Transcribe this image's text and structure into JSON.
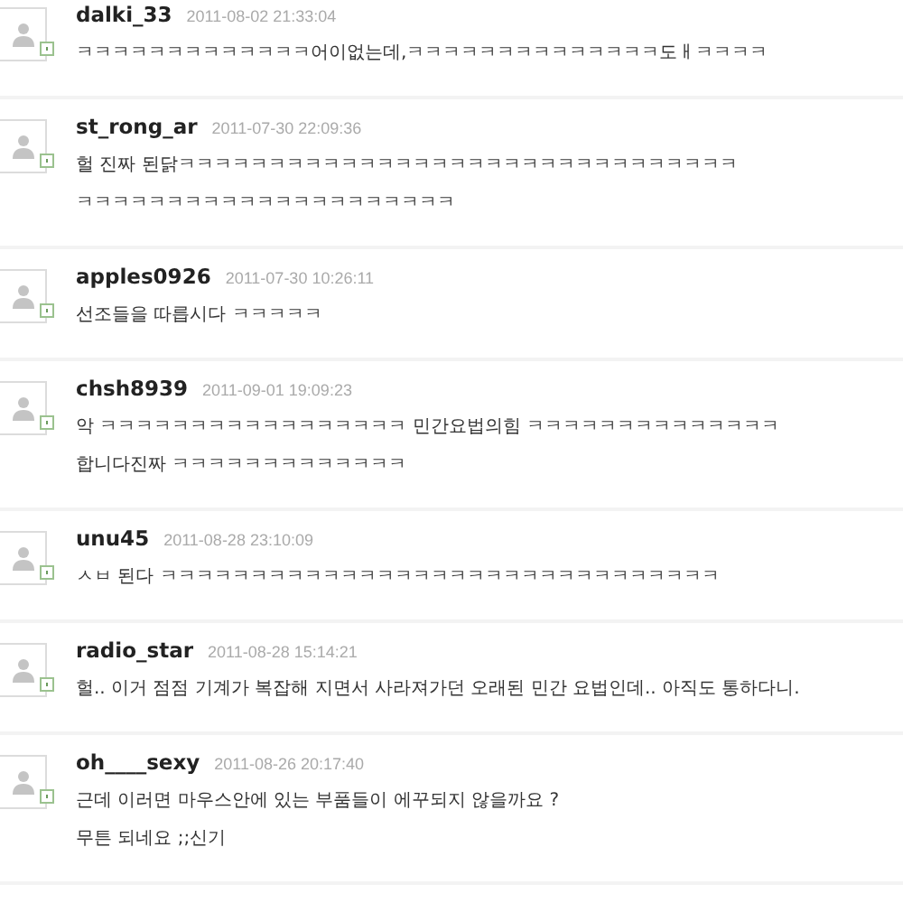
{
  "comments": [
    {
      "user": "dalki_33",
      "date": "2011-08-02 21:33:04",
      "lines": [
        "ㅋㅋㅋㅋㅋㅋㅋㅋㅋㅋㅋㅋㅋ어이없는데,ㅋㅋㅋㅋㅋㅋㅋㅋㅋㅋㅋㅋㅋㅋ도ㅐㅋㅋㅋㅋ"
      ]
    },
    {
      "user": "st_rong_ar",
      "date": "2011-07-30 22:09:36",
      "lines": [
        "헐 진짜 된닭ㅋㅋㅋㅋㅋㅋㅋㅋㅋㅋㅋㅋㅋㅋㅋㅋㅋㅋㅋㅋㅋㅋㅋㅋㅋㅋㅋㅋㅋㅋㅋ",
        "ㅋㅋㅋㅋㅋㅋㅋㅋㅋㅋㅋㅋㅋㅋㅋㅋㅋㅋㅋㅋㅋ"
      ]
    },
    {
      "user": "apples0926",
      "date": "2011-07-30 10:26:11",
      "lines": [
        "선조들을 따릅시다 ㅋㅋㅋㅋㅋ"
      ]
    },
    {
      "user": "chsh8939",
      "date": "2011-09-01 19:09:23",
      "lines": [
        "악 ㅋㅋㅋㅋㅋㅋㅋㅋㅋㅋㅋㅋㅋㅋㅋㅋㅋ 민간요법의힘 ㅋㅋㅋㅋㅋㅋㅋㅋㅋㅋㅋㅋㅋㅋ",
        "합니다진짜 ㅋㅋㅋㅋㅋㅋㅋㅋㅋㅋㅋㅋㅋ"
      ]
    },
    {
      "user": "unu45",
      "date": "2011-08-28 23:10:09",
      "lines": [
        "ㅅㅂ 된다 ㅋㅋㅋㅋㅋㅋㅋㅋㅋㅋㅋㅋㅋㅋㅋㅋㅋㅋㅋㅋㅋㅋㅋㅋㅋㅋㅋㅋㅋㅋㅋ"
      ]
    },
    {
      "user": "radio_star",
      "date": "2011-08-28 15:14:21",
      "lines": [
        "헐.. 이거 점점 기계가 복잡해 지면서 사라져가던 오래된 민간 요법인데.. 아직도 통하다니."
      ]
    },
    {
      "user": "oh____sexy",
      "date": "2011-08-26 20:17:40",
      "lines": [
        "근데 이러면 마우스안에 있는 부품들이 에꾸되지 않을까요 ?",
        "무튼 되네요 ;;신기"
      ]
    }
  ]
}
